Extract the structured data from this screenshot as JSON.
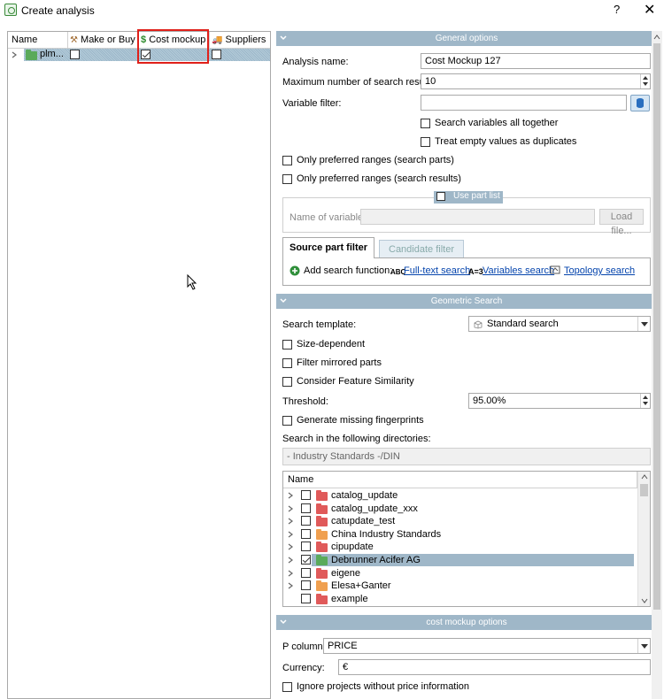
{
  "window": {
    "title": "Create analysis",
    "help": "?",
    "close": "✕"
  },
  "left_tree": {
    "columns": [
      "Name",
      "Make or Buy",
      "Cost mockup",
      "Suppliers"
    ],
    "row": {
      "name": "plm...",
      "make_or_buy": false,
      "cost_mockup": true,
      "suppliers": false
    }
  },
  "general": {
    "header": "General options",
    "analysis_name_label": "Analysis name:",
    "analysis_name_value": "Cost Mockup 127",
    "max_results_label": "Maximum number of search result:",
    "max_results_value": "10",
    "variable_filter_label": "Variable filter:",
    "variable_filter_value": "",
    "search_vars_together": "Search variables all together",
    "treat_empty_duplicates": "Treat empty values as duplicates",
    "only_pref_parts": "Only preferred ranges (search parts)",
    "only_pref_results": "Only preferred ranges (search results)",
    "use_part_list": "Use part list",
    "name_of_variable_label": "Name of variable:",
    "load_file": "Load file...",
    "tabs": [
      "Source part filter",
      "Candidate filter"
    ],
    "add_search_function": "Add search function:",
    "fulltext_icon": "ABC",
    "fulltext": "Full-text search",
    "variables_icon": "A=3",
    "variables": "Variables search",
    "topology": "Topology search"
  },
  "geometric": {
    "header": "Geometric Search",
    "template_label": "Search template:",
    "template_value": "Standard search",
    "size_dependent": "Size-dependent",
    "filter_mirrored": "Filter mirrored parts",
    "feature_similarity": "Consider Feature Similarity",
    "threshold_label": "Threshold:",
    "threshold_value": "95.00%",
    "gen_fingerprints": "Generate missing fingerprints",
    "search_dirs_label": "Search in the following directories:",
    "dir_path": "- Industry Standards -/DIN",
    "list_header": "Name",
    "directories": [
      {
        "name": "catalog_update",
        "checked": false,
        "color": "#e05a5a",
        "expandable": true
      },
      {
        "name": "catalog_update_xxx",
        "checked": false,
        "color": "#e05a5a",
        "expandable": true
      },
      {
        "name": "catupdate_test",
        "checked": false,
        "color": "#e05a5a",
        "expandable": true
      },
      {
        "name": "China Industry Standards",
        "checked": false,
        "color": "#f0a050",
        "expandable": true
      },
      {
        "name": "cipupdate",
        "checked": false,
        "color": "#e05a5a",
        "expandable": true
      },
      {
        "name": "Debrunner Acifer AG",
        "checked": true,
        "color": "#5aaa5a",
        "expandable": true,
        "selected": true
      },
      {
        "name": "eigene",
        "checked": false,
        "color": "#e05a5a",
        "expandable": true
      },
      {
        "name": "Elesa+Ganter",
        "checked": false,
        "color": "#f0a050",
        "expandable": true
      },
      {
        "name": "example",
        "checked": false,
        "color": "#e05a5a",
        "expandable": false
      }
    ]
  },
  "cost": {
    "header": "cost mockup options",
    "p_column_label": "P column:",
    "p_column_value": "PRICE",
    "currency_label": "Currency:",
    "currency_value": "€",
    "ignore_projects": "Ignore projects without price information"
  }
}
